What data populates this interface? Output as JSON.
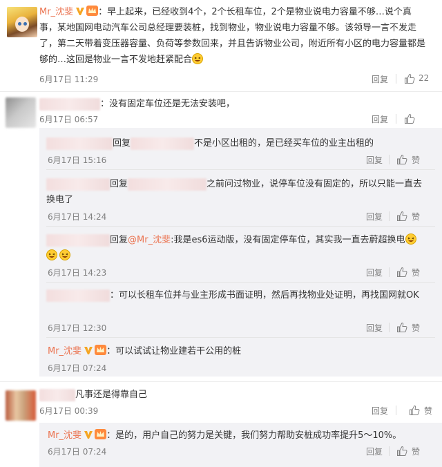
{
  "comments": [
    {
      "username": "Mr_沈斐",
      "text_line1": "：早上起来，已经收到4个，2个长租车位，2个是物业说电力容量不够…说个真",
      "text_line2": "事，某地国网电动汽车公司总经理要装桩，找到物业，物业说电力容量不够。该领导一言不发走",
      "text_line3": "了，第二天带着变压器容量、负荷等参数回来，并且告诉物业公司，附近所有小区的电力容量都是",
      "text_line4": "够的…这回是物业一言不发地赶紧配合",
      "time": "6月17日 11:29",
      "reply": "回复",
      "likes": "22"
    },
    {
      "text": "：没有固定车位还是无法安装吧，",
      "time": "6月17日 06:57",
      "reply": "回复"
    }
  ],
  "replies": [
    {
      "prefix": "回复",
      "text": "不是小区出租的，是已经买车位的业主出租的",
      "time": "6月17日 15:16",
      "reply": "回复",
      "like": "赞"
    },
    {
      "prefix": "回复",
      "text_line1": "之前问过物业，说停车位没有固定的，所以只能一直去",
      "text_line2": "换电了",
      "time": "6月17日 14:24",
      "reply": "回复",
      "like": "赞"
    },
    {
      "prefix": "回复",
      "mention": "@Mr_沈斐",
      "text": ":我是es6运动版，没有固定停车位，其实我一直去蔚超换电",
      "time": "6月17日 14:23",
      "reply": "回复",
      "like": "赞"
    },
    {
      "text": "：可以长租车位并与业主形成书面证明，然后再找物业处证明，再找国网就OK",
      "time": "6月17日 12:30",
      "reply": "回复",
      "like": "赞"
    },
    {
      "username": "Mr_沈斐",
      "text": "：可以试试让物业建若干公用的桩",
      "time": "6月17日 07:24",
      "reply": "回复",
      "like": "赞"
    }
  ],
  "comment3": {
    "text": "凡事还是得靠自己",
    "time": "6月17日 00:39",
    "reply": "回复",
    "like": "赞"
  },
  "reply_last": {
    "username": "Mr_沈斐",
    "text": "：是的，用户自己的努力是关键，我们努力帮助安桩成功率提升5～10%。",
    "time": "6月17日 07:24",
    "reply": "回复",
    "like": "赞"
  },
  "colors": {
    "username": "#eb7350",
    "text": "#333333",
    "meta": "#808080",
    "sub_bg": "#f2f2f5"
  },
  "icons": [
    "verified-v-icon",
    "crown-badge-icon",
    "thumbs-up-icon",
    "laughing-emoji-icon"
  ]
}
